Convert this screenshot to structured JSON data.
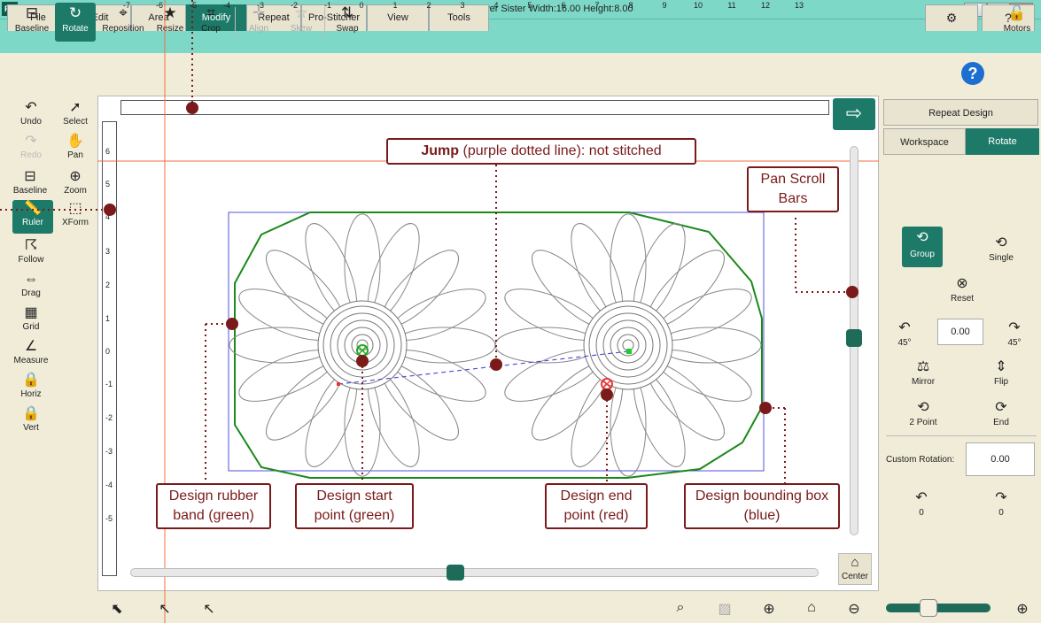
{
  "window": {
    "title": "Pro-Stitcher Premium   -   Repeat Sunflower Sister   Width:16.00   Height:8.00",
    "app_icon": "PS",
    "minimize": "–",
    "maximize": "□",
    "close": "✕"
  },
  "tabs": [
    "File",
    "Edit",
    "Area",
    "Modify",
    "Repeat",
    "Pro-Stitcher",
    "View",
    "Tools"
  ],
  "tab_right": {
    "settings_icon": "⚙",
    "help_icon": "?"
  },
  "toolbar": {
    "baseline": "Baseline",
    "rotate": "Rotate",
    "reposition": "Reposition",
    "resize": "Resize",
    "crop": "Crop",
    "align": "Align",
    "skew": "Skew",
    "swap": "Swap",
    "motors": "Motors"
  },
  "left_tools": {
    "undo": "Undo",
    "select": "Select",
    "redo": "Redo",
    "pan": "Pan",
    "baseline": "Baseline",
    "zoom": "Zoom",
    "ruler": "Ruler",
    "xform": "XForm",
    "follow": "Follow",
    "drag": "Drag",
    "grid": "Grid",
    "measure": "Measure",
    "horiz": "Horiz",
    "vert": "Vert"
  },
  "hruler": [
    "-7",
    "-6",
    "-5",
    "-4",
    "-3",
    "-2",
    "-1",
    "0",
    "1",
    "2",
    "3",
    "4",
    "5",
    "6",
    "7",
    "8",
    "9",
    "10",
    "11",
    "12",
    "13"
  ],
  "vruler": [
    "6",
    "5",
    "4",
    "3",
    "2",
    "1",
    "0",
    "-1",
    "-2",
    "-3",
    "-4",
    "-5"
  ],
  "center_label": "Center",
  "right_panel": {
    "repeat_design": "Repeat Design",
    "workspace": "Workspace",
    "rotate": "Rotate",
    "group": "Group",
    "single": "Single",
    "reset": "Reset",
    "left45": "45°",
    "right45": "45°",
    "rotation_value": "0.00",
    "mirror": "Mirror",
    "flip": "Flip",
    "two_point": "2 Point",
    "end": "End",
    "custom_rotation_label": "Custom Rotation:",
    "custom_rotation_value": "0.00",
    "ccw0": "0",
    "cw0": "0"
  },
  "callouts": {
    "jump_bold": "Jump",
    "jump_rest": " (purple dotted line): not stitched",
    "pan_scroll": "Pan Scroll Bars",
    "rubber_band": "Design rubber band (green)",
    "start_point": "Design start point (green)",
    "end_point": "Design end point (red)",
    "bounding_box": "Design bounding box (blue)"
  },
  "colors": {
    "accent": "#1e7a68",
    "titlebar": "#7dd8c8",
    "callout": "#7a1a1a",
    "rubber_band": "#1a8a1a",
    "bounding_box": "#5050e0",
    "jump": "#5050e0",
    "guide": "#f07040"
  }
}
